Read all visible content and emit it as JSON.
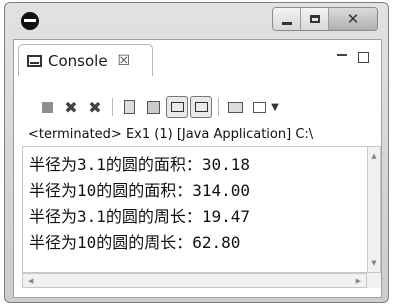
{
  "window": {
    "title": "",
    "buttons": {
      "minimize": "_",
      "maximize": "□",
      "close": "✕"
    }
  },
  "view": {
    "tab_label": "Console",
    "tab_close": "☒"
  },
  "toolbar": {
    "buttons": [
      "terminate-icon",
      "remove-launch-icon",
      "remove-all-terminated-icon",
      "clear-console-icon",
      "scroll-lock-icon",
      "show-on-stdout-icon",
      "show-on-stderr-icon",
      "pin-console-icon",
      "display-selected-console-icon",
      "open-console-dropdown-icon"
    ]
  },
  "status": "<terminated> Ex1 (1) [Java Application] C:\\",
  "output": {
    "lines": [
      "半径为3.1的圆的面积：30.18",
      "半径为10的圆的面积：314.00",
      "半径为3.1的圆的周长：19.47",
      "半径为10的圆的周长：62.80"
    ]
  }
}
